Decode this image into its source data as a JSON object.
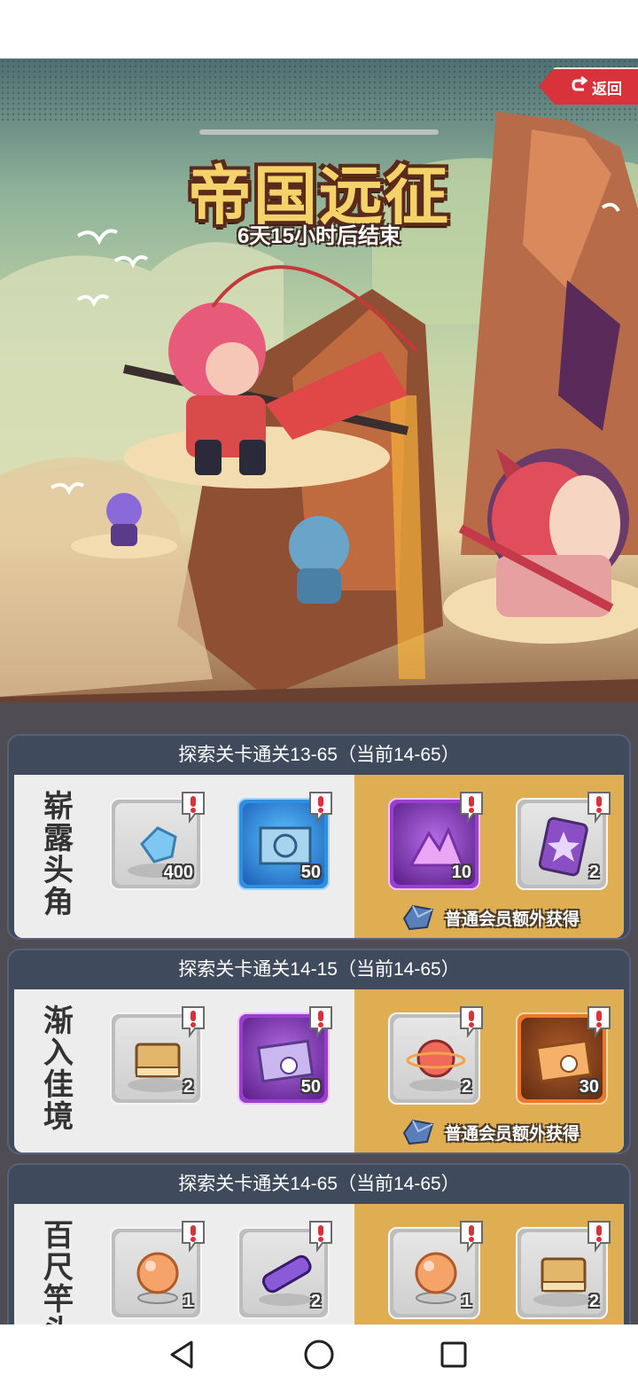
{
  "header": {
    "back_label": "返回",
    "title": "帝国远征",
    "countdown": "6天15小时后结束"
  },
  "tiers": [
    {
      "header": "探索关卡通关13-65（当前14-65）",
      "name": "崭露头角",
      "free_rewards": [
        {
          "icon": "blue-crystal-icon",
          "count": "400",
          "rarity": "grey"
        },
        {
          "icon": "map-scroll-icon",
          "count": "50",
          "rarity": "blue"
        }
      ],
      "premium_rewards": [
        {
          "icon": "purple-crystal-cluster-icon",
          "count": "10",
          "rarity": "purple"
        },
        {
          "icon": "star-card-icon",
          "count": "2",
          "rarity": "grey"
        }
      ],
      "bonus_label": "普通会员额外获得"
    },
    {
      "header": "探索关卡通关14-15（当前14-65）",
      "name": "渐入佳境",
      "free_rewards": [
        {
          "icon": "book-icon",
          "count": "2",
          "rarity": "grey"
        },
        {
          "icon": "purple-map-icon",
          "count": "50",
          "rarity": "purple"
        }
      ],
      "premium_rewards": [
        {
          "icon": "planet-orb-icon",
          "count": "2",
          "rarity": "grey"
        },
        {
          "icon": "orange-map-icon",
          "count": "30",
          "rarity": "orange"
        }
      ],
      "bonus_label": "普通会员额外获得"
    },
    {
      "header": "探索关卡通关14-65（当前14-65）",
      "name": "百尺竿头",
      "free_rewards": [
        {
          "icon": "crystal-ball-icon",
          "count": "1",
          "rarity": "grey"
        },
        {
          "icon": "telescope-icon",
          "count": "2",
          "rarity": "grey"
        }
      ],
      "premium_rewards": [
        {
          "icon": "crystal-ball-icon",
          "count": "1",
          "rarity": "grey"
        },
        {
          "icon": "book-icon",
          "count": "2",
          "rarity": "grey"
        }
      ],
      "bonus_label": ""
    }
  ],
  "colors": {
    "panel_bg": "#3f4a5c",
    "premium_zone": "#dfae52",
    "back_button": "#d8323b",
    "title_gold": "#f6d36a"
  }
}
